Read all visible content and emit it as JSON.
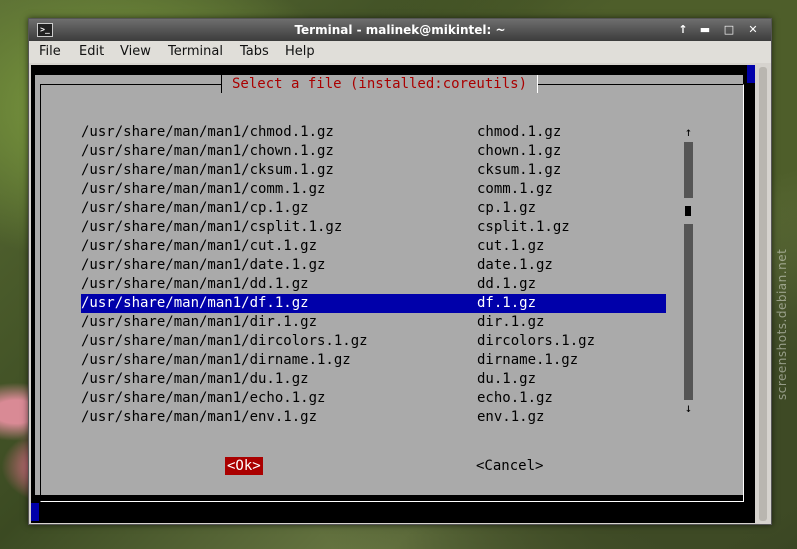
{
  "window": {
    "title": "Terminal - malinek@mikintel: ~",
    "controls": [
      "↑",
      "▬",
      "□",
      "✕"
    ]
  },
  "menu": [
    "File",
    "Edit",
    "View",
    "Terminal",
    "Tabs",
    "Help"
  ],
  "dialog": {
    "title": "Select a file (installed:coreutils)",
    "files": [
      {
        "path": "/usr/share/man/man1/chmod.1.gz",
        "name": "chmod.1.gz"
      },
      {
        "path": "/usr/share/man/man1/chown.1.gz",
        "name": "chown.1.gz"
      },
      {
        "path": "/usr/share/man/man1/cksum.1.gz",
        "name": "cksum.1.gz"
      },
      {
        "path": "/usr/share/man/man1/comm.1.gz",
        "name": "comm.1.gz"
      },
      {
        "path": "/usr/share/man/man1/cp.1.gz",
        "name": "cp.1.gz"
      },
      {
        "path": "/usr/share/man/man1/csplit.1.gz",
        "name": "csplit.1.gz"
      },
      {
        "path": "/usr/share/man/man1/cut.1.gz",
        "name": "cut.1.gz"
      },
      {
        "path": "/usr/share/man/man1/date.1.gz",
        "name": "date.1.gz"
      },
      {
        "path": "/usr/share/man/man1/dd.1.gz",
        "name": "dd.1.gz"
      },
      {
        "path": "/usr/share/man/man1/df.1.gz",
        "name": "df.1.gz",
        "selected": true
      },
      {
        "path": "/usr/share/man/man1/dir.1.gz",
        "name": "dir.1.gz"
      },
      {
        "path": "/usr/share/man/man1/dircolors.1.gz",
        "name": "dircolors.1.gz"
      },
      {
        "path": "/usr/share/man/man1/dirname.1.gz",
        "name": "dirname.1.gz"
      },
      {
        "path": "/usr/share/man/man1/du.1.gz",
        "name": "du.1.gz"
      },
      {
        "path": "/usr/share/man/man1/echo.1.gz",
        "name": "echo.1.gz"
      },
      {
        "path": "/usr/share/man/man1/env.1.gz",
        "name": "env.1.gz"
      }
    ],
    "scroll_up": "↑",
    "scroll_down": "↓",
    "ok_label": "<Ok>",
    "cancel_label": "<Cancel>"
  },
  "watermark": "screenshots.debian.net",
  "colors": {
    "dialog_bg": "#aaaaaa",
    "selection_bg": "#0000aa",
    "title_fg": "#aa0000",
    "ok_bg": "#aa0000"
  }
}
